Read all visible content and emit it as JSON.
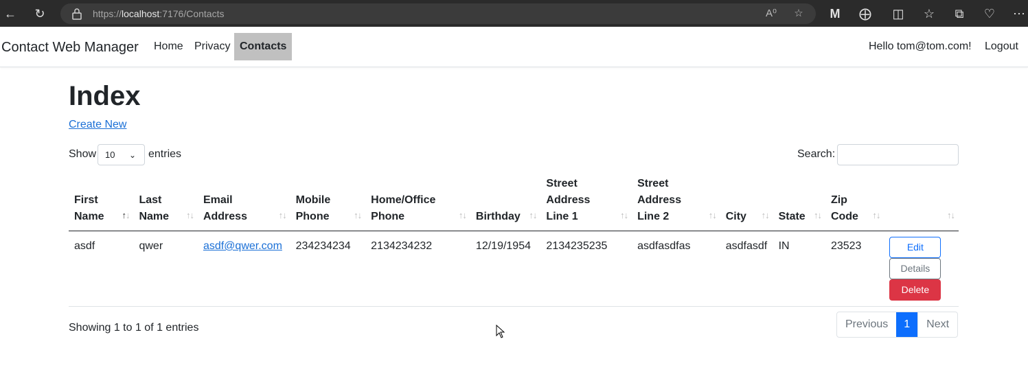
{
  "browser": {
    "url_prefix": "https://",
    "url_host": "localhost",
    "url_rest": ":7176/Contacts"
  },
  "navbar": {
    "brand": "Contact Web Manager",
    "links": [
      "Home",
      "Privacy",
      "Contacts"
    ],
    "active": "Contacts",
    "greeting": "Hello tom@tom.com!",
    "logout": "Logout"
  },
  "page": {
    "title": "Index",
    "create_link": "Create New"
  },
  "table_controls": {
    "show_label": "Show",
    "page_size": "10",
    "entries_label": "entries",
    "search_label": "Search:",
    "search_value": ""
  },
  "table": {
    "headers": [
      [
        "First",
        "Name"
      ],
      [
        "Last",
        "Name"
      ],
      [
        "Email",
        "Address"
      ],
      [
        "Mobile",
        "Phone"
      ],
      [
        "Home/Office",
        "Phone"
      ],
      [
        "Birthday"
      ],
      [
        "Street",
        "Address",
        "Line 1"
      ],
      [
        "Street",
        "Address",
        "Line 2"
      ],
      [
        "City"
      ],
      [
        "State"
      ],
      [
        "Zip",
        "Code"
      ],
      [
        ""
      ]
    ],
    "rows": [
      {
        "first_name": "asdf",
        "last_name": "qwer",
        "email": "asdf@qwer.com",
        "mobile": "234234234",
        "home_phone": "2134234232",
        "birthday": "12/19/1954",
        "street1": "2134235235",
        "street2": "asdfasdfas",
        "city": "asdfasdf",
        "state": "IN",
        "zip": "23523",
        "actions": {
          "edit": "Edit",
          "details": "Details",
          "delete": "Delete"
        }
      }
    ]
  },
  "footer": {
    "info": "Showing 1 to 1 of 1 entries",
    "previous": "Previous",
    "current_page": "1",
    "next": "Next"
  },
  "colors": {
    "primary": "#0d6efd",
    "danger": "#dc3545",
    "secondary": "#6c757d",
    "active_nav": "#c0c0c0"
  }
}
